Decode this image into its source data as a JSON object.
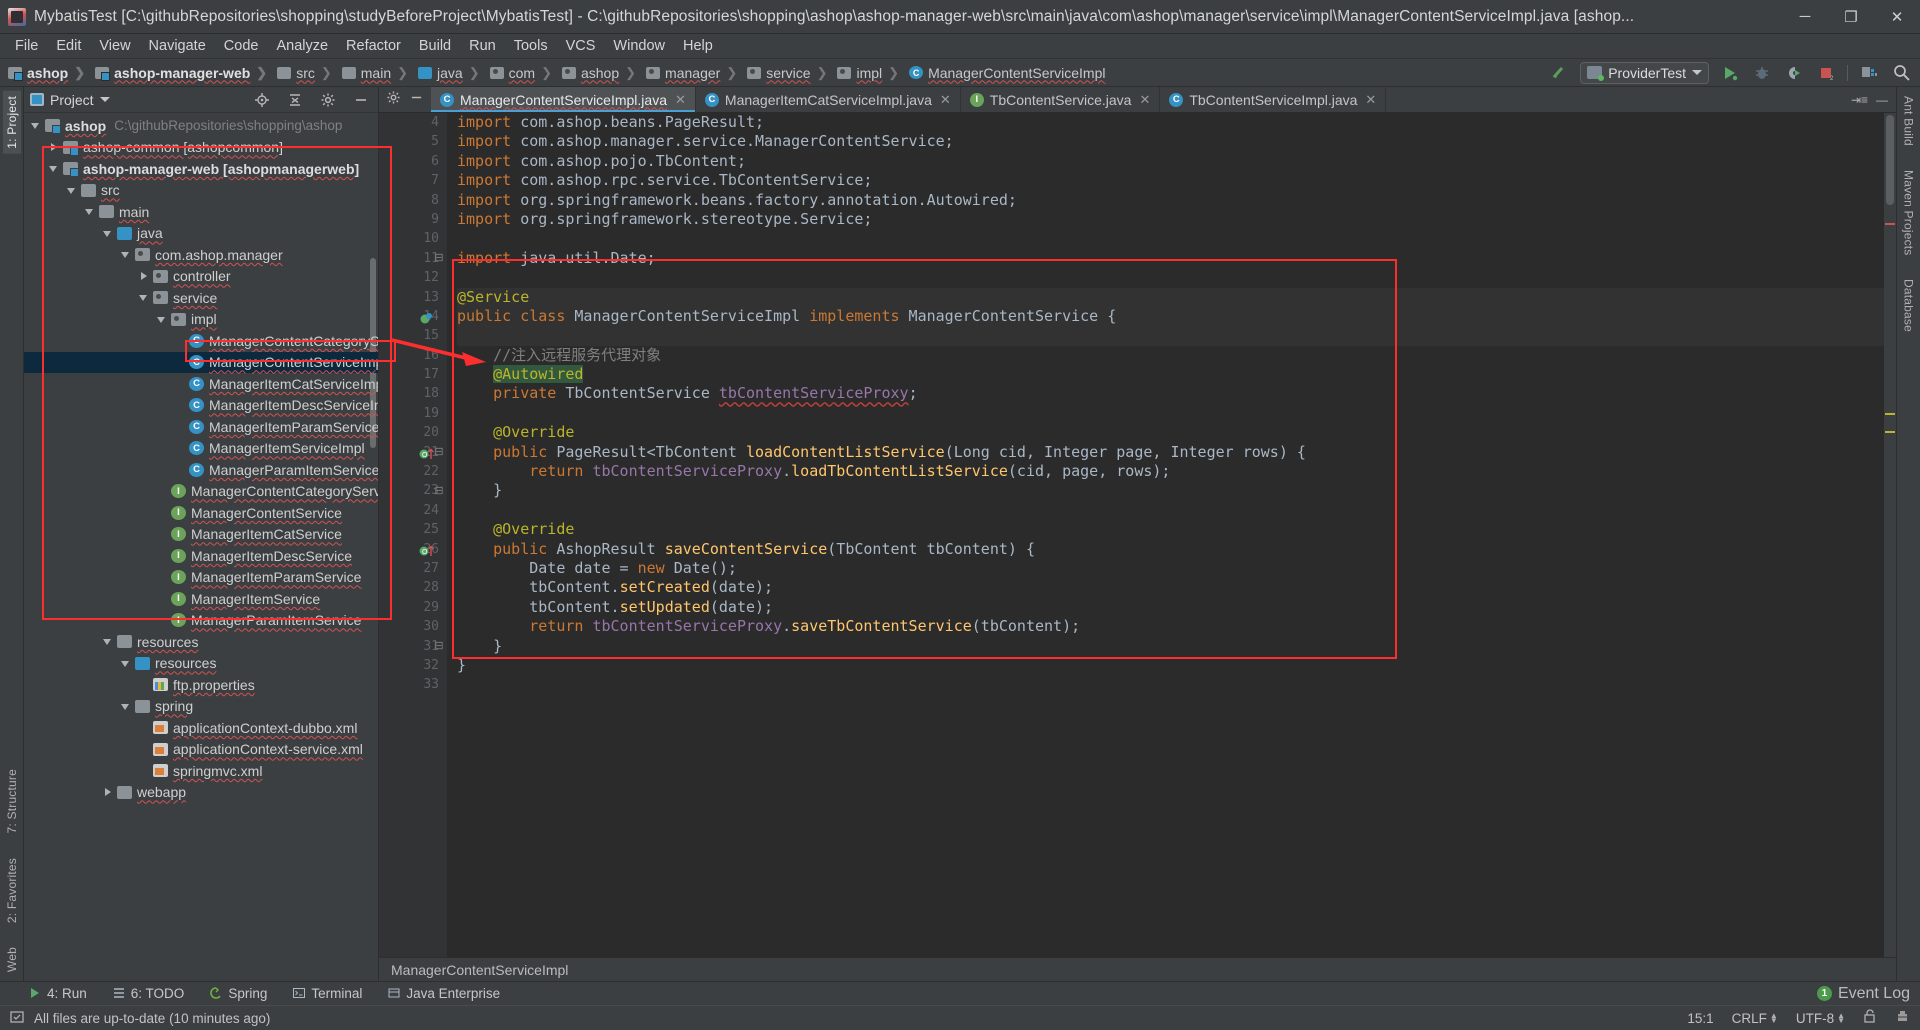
{
  "window": {
    "title": "MybatisTest [C:\\githubRepositories\\shopping\\studyBeforeProject\\MybatisTest] - C:\\githubRepositories\\shopping\\ashop\\ashop-manager-web\\src\\main\\java\\com\\ashop\\manager\\service\\impl\\ManagerContentServiceImpl.java [ashop...",
    "minimize": "─",
    "maximize": "❐",
    "close": "✕"
  },
  "menubar": {
    "items": [
      "File",
      "Edit",
      "View",
      "Navigate",
      "Code",
      "Analyze",
      "Refactor",
      "Build",
      "Run",
      "Tools",
      "VCS",
      "Window",
      "Help"
    ]
  },
  "navbar": {
    "crumbs": [
      {
        "label": "ashop",
        "icon": "module-icon",
        "bold": true
      },
      {
        "label": "ashop-manager-web",
        "icon": "module-icon",
        "bold": true
      },
      {
        "label": "src",
        "icon": "folder-icon",
        "bold": false
      },
      {
        "label": "main",
        "icon": "folder-icon",
        "bold": false
      },
      {
        "label": "java",
        "icon": "source-folder-icon",
        "bold": false
      },
      {
        "label": "com",
        "icon": "package-icon",
        "bold": false
      },
      {
        "label": "ashop",
        "icon": "package-icon",
        "bold": false
      },
      {
        "label": "manager",
        "icon": "package-icon",
        "bold": false
      },
      {
        "label": "service",
        "icon": "package-icon",
        "bold": false
      },
      {
        "label": "impl",
        "icon": "package-icon",
        "bold": false
      },
      {
        "label": "ManagerContentServiceImpl",
        "icon": "class-icon",
        "bold": false
      }
    ],
    "run_config": "ProviderTest",
    "icons": [
      "build-hammer-icon",
      "run-icon",
      "debug-icon",
      "run-with-coverage-icon",
      "stop-icon",
      "project-structure-icon",
      "search-icon"
    ]
  },
  "project_panel": {
    "title": "Project",
    "header_icons": [
      "locate-icon",
      "collapse-all-icon",
      "settings-icon",
      "hide-icon"
    ],
    "tree": [
      {
        "indent": 0,
        "arrow": "open",
        "icon": "module-icon",
        "label": "ashop",
        "bold": true,
        "path": "C:\\githubRepositories\\shopping\\ashop"
      },
      {
        "indent": 1,
        "arrow": "closed",
        "icon": "module-icon",
        "label": "ashop-common [ashopcommon]",
        "bold": false,
        "path": ""
      },
      {
        "indent": 1,
        "arrow": "open",
        "icon": "module-icon",
        "label": "ashop-manager-web [ashopmanagerweb]",
        "bold": true,
        "path": ""
      },
      {
        "indent": 2,
        "arrow": "open",
        "icon": "folder-icon",
        "label": "src",
        "bold": false,
        "path": ""
      },
      {
        "indent": 3,
        "arrow": "open",
        "icon": "folder-icon",
        "label": "main",
        "bold": false,
        "path": ""
      },
      {
        "indent": 4,
        "arrow": "open",
        "icon": "source-folder-icon",
        "label": "java",
        "bold": false,
        "path": ""
      },
      {
        "indent": 5,
        "arrow": "open",
        "icon": "package-icon",
        "label": "com.ashop.manager",
        "bold": false,
        "path": ""
      },
      {
        "indent": 6,
        "arrow": "closed",
        "icon": "package-icon",
        "label": "controller",
        "bold": false,
        "path": ""
      },
      {
        "indent": 6,
        "arrow": "open",
        "icon": "package-icon",
        "label": "service",
        "bold": false,
        "path": ""
      },
      {
        "indent": 7,
        "arrow": "open",
        "icon": "package-icon",
        "label": "impl",
        "bold": false,
        "path": ""
      },
      {
        "indent": 8,
        "arrow": "none",
        "icon": "class-icon",
        "label": "ManagerContentCategorySe",
        "bold": false,
        "path": ""
      },
      {
        "indent": 8,
        "arrow": "none",
        "icon": "class-icon",
        "label": "ManagerContentServiceImpl",
        "bold": false,
        "path": "",
        "selected": true
      },
      {
        "indent": 8,
        "arrow": "none",
        "icon": "class-icon",
        "label": "ManagerItemCatServiceImpl",
        "bold": false,
        "path": ""
      },
      {
        "indent": 8,
        "arrow": "none",
        "icon": "class-icon",
        "label": "ManagerItemDescServiceImpl",
        "bold": false,
        "path": ""
      },
      {
        "indent": 8,
        "arrow": "none",
        "icon": "class-icon",
        "label": "ManagerItemParamServiceIn",
        "bold": false,
        "path": ""
      },
      {
        "indent": 8,
        "arrow": "none",
        "icon": "class-icon",
        "label": "ManagerItemServiceImpl",
        "bold": false,
        "path": ""
      },
      {
        "indent": 8,
        "arrow": "none",
        "icon": "class-icon",
        "label": "ManagerParamItemServiceIn",
        "bold": false,
        "path": ""
      },
      {
        "indent": 7,
        "arrow": "none",
        "icon": "interface-icon",
        "label": "ManagerContentCategoryServi",
        "bold": false,
        "path": ""
      },
      {
        "indent": 7,
        "arrow": "none",
        "icon": "interface-icon",
        "label": "ManagerContentService",
        "bold": false,
        "path": ""
      },
      {
        "indent": 7,
        "arrow": "none",
        "icon": "interface-icon",
        "label": "ManagerItemCatService",
        "bold": false,
        "path": ""
      },
      {
        "indent": 7,
        "arrow": "none",
        "icon": "interface-icon",
        "label": "ManagerItemDescService",
        "bold": false,
        "path": ""
      },
      {
        "indent": 7,
        "arrow": "none",
        "icon": "interface-icon",
        "label": "ManagerItemParamService",
        "bold": false,
        "path": ""
      },
      {
        "indent": 7,
        "arrow": "none",
        "icon": "interface-icon",
        "label": "ManagerItemService",
        "bold": false,
        "path": ""
      },
      {
        "indent": 7,
        "arrow": "none",
        "icon": "interface-icon",
        "label": "ManagerParamItemService",
        "bold": false,
        "path": ""
      },
      {
        "indent": 4,
        "arrow": "open",
        "icon": "folder-icon",
        "label": "resources",
        "bold": false,
        "path": ""
      },
      {
        "indent": 5,
        "arrow": "open",
        "icon": "source-folder-icon",
        "label": "resources",
        "bold": false,
        "path": ""
      },
      {
        "indent": 6,
        "arrow": "none",
        "icon": "properties-icon",
        "label": "ftp.properties",
        "bold": false,
        "path": ""
      },
      {
        "indent": 5,
        "arrow": "open",
        "icon": "folder-icon",
        "label": "spring",
        "bold": false,
        "path": ""
      },
      {
        "indent": 6,
        "arrow": "none",
        "icon": "xml-icon",
        "label": "applicationContext-dubbo.xml",
        "bold": false,
        "path": ""
      },
      {
        "indent": 6,
        "arrow": "none",
        "icon": "xml-icon",
        "label": "applicationContext-service.xml",
        "bold": false,
        "path": ""
      },
      {
        "indent": 6,
        "arrow": "none",
        "icon": "xml-icon",
        "label": "springmvc.xml",
        "bold": false,
        "path": ""
      },
      {
        "indent": 4,
        "arrow": "closed",
        "icon": "folder-icon",
        "label": "webapp",
        "bold": false,
        "path": ""
      }
    ]
  },
  "left_rail": {
    "top": [
      "1: Project"
    ],
    "bottom": [
      "7: Structure",
      "2: Favorites",
      "Web"
    ]
  },
  "right_rail": {
    "items": [
      "Ant Build",
      "Maven Projects",
      "Database"
    ]
  },
  "editor": {
    "tabs": [
      {
        "label": "ManagerContentServiceImpl.java",
        "icon": "class-icon",
        "active": true
      },
      {
        "label": "ManagerItemCatServiceImpl.java",
        "icon": "class-icon",
        "active": false
      },
      {
        "label": "TbContentService.java",
        "icon": "interface-icon",
        "active": false
      },
      {
        "label": "TbContentServiceImpl.java",
        "icon": "class-icon",
        "active": false
      }
    ],
    "first_line_number": 4,
    "lines": [
      {
        "n": 4,
        "text": "import com.ashop.beans.PageResult;"
      },
      {
        "n": 5,
        "text": "import com.ashop.manager.service.ManagerContentService;"
      },
      {
        "n": 6,
        "text": "import com.ashop.pojo.TbContent;"
      },
      {
        "n": 7,
        "text": "import com.ashop.rpc.service.TbContentService;"
      },
      {
        "n": 8,
        "text": "import org.springframework.beans.factory.annotation.Autowired;"
      },
      {
        "n": 9,
        "text": "import org.springframework.stereotype.Service;"
      },
      {
        "n": 10,
        "text": ""
      },
      {
        "n": 11,
        "text": "import java.util.Date;"
      },
      {
        "n": 12,
        "text": ""
      },
      {
        "n": 13,
        "text": "@Service"
      },
      {
        "n": 14,
        "text": "public class ManagerContentServiceImpl implements ManagerContentService {"
      },
      {
        "n": 15,
        "text": ""
      },
      {
        "n": 16,
        "text": "    //注入远程服务代理对象"
      },
      {
        "n": 17,
        "text": "    @Autowired"
      },
      {
        "n": 18,
        "text": "    private TbContentService tbContentServiceProxy;"
      },
      {
        "n": 19,
        "text": ""
      },
      {
        "n": 20,
        "text": "    @Override"
      },
      {
        "n": 21,
        "text": "    public PageResult<TbContent> loadContentListService(Long cid, Integer page, Integer rows) {"
      },
      {
        "n": 22,
        "text": "        return tbContentServiceProxy.loadTbContentListService(cid, page, rows);"
      },
      {
        "n": 23,
        "text": "    }"
      },
      {
        "n": 24,
        "text": ""
      },
      {
        "n": 25,
        "text": "    @Override"
      },
      {
        "n": 26,
        "text": "    public AshopResult saveContentService(TbContent tbContent) {"
      },
      {
        "n": 27,
        "text": "        Date date = new Date();"
      },
      {
        "n": 28,
        "text": "        tbContent.setCreated(date);"
      },
      {
        "n": 29,
        "text": "        tbContent.setUpdated(date);"
      },
      {
        "n": 30,
        "text": "        return tbContentServiceProxy.saveTbContentService(tbContent);"
      },
      {
        "n": 31,
        "text": "    }"
      },
      {
        "n": 32,
        "text": "}"
      },
      {
        "n": 33,
        "text": ""
      }
    ],
    "breadcrumb": "ManagerContentServiceImpl"
  },
  "bottom_strip": {
    "items": [
      {
        "label": "4: Run",
        "icon": "run-icon"
      },
      {
        "label": "6: TODO",
        "icon": "todo-icon"
      },
      {
        "label": "Spring",
        "icon": "spring-icon"
      },
      {
        "label": "Terminal",
        "icon": "terminal-icon"
      },
      {
        "label": "Java Enterprise",
        "icon": "java-enterprise-icon"
      }
    ],
    "event_log": "Event Log",
    "event_count": "1"
  },
  "statusbar": {
    "message": "All files are up-to-date (10 minutes ago)",
    "caret_position": "15:1",
    "line_separator": "CRLF",
    "encoding": "UTF-8",
    "lock_icon": "unlocked-icon",
    "inspector_icon": "hector-icon"
  },
  "annotations": {
    "accent_color": "#fd2e2e"
  }
}
